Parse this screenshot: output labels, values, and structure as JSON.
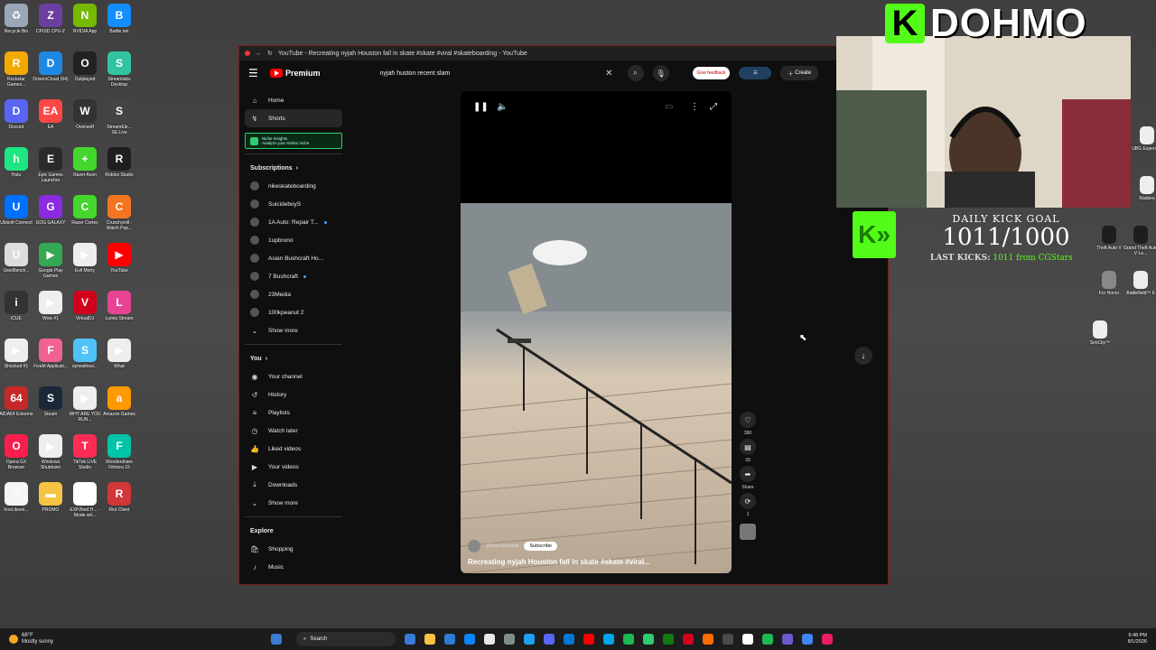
{
  "desktop": {
    "icons": [
      {
        "label": "Recycle Bin",
        "color": "#9aa7b8",
        "glyph": "♻"
      },
      {
        "label": "CPUID CPU-Z",
        "color": "#6b3fa0",
        "glyph": "Z"
      },
      {
        "label": "NVIDIA App",
        "color": "#76b900",
        "glyph": "N"
      },
      {
        "label": "Battle.net",
        "color": "#148eff",
        "glyph": "B"
      },
      {
        "label": "Rockstar Games...",
        "color": "#f2a900",
        "glyph": "R"
      },
      {
        "label": "DriversCloud (64)",
        "color": "#1e88e5",
        "glyph": "D"
      },
      {
        "label": "Outplayed",
        "color": "#222222",
        "glyph": "O"
      },
      {
        "label": "Streamlabs Desktop",
        "color": "#31c3a2",
        "glyph": "S"
      },
      {
        "label": "Discord",
        "color": "#5865f2",
        "glyph": "D"
      },
      {
        "label": "EA",
        "color": "#ff4747",
        "glyph": "EA"
      },
      {
        "label": "Overwolf",
        "color": "#333333",
        "glyph": "W"
      },
      {
        "label": "StreamEle... SE.Live",
        "color": "#444444",
        "glyph": "S"
      },
      {
        "label": "Hulu",
        "color": "#1ce783",
        "glyph": "h"
      },
      {
        "label": "Epic Games Launcher",
        "color": "#2a2a2a",
        "glyph": "E"
      },
      {
        "label": "Razer Axon",
        "color": "#44d62c",
        "glyph": "+"
      },
      {
        "label": "Roblox Studio",
        "color": "#1f1f1f",
        "glyph": "R"
      },
      {
        "label": "Ubisoft Connect",
        "color": "#0070ff",
        "glyph": "U"
      },
      {
        "label": "GOG GALAXY",
        "color": "#8a2be2",
        "glyph": "G"
      },
      {
        "label": "Razer Cortex",
        "color": "#44d62c",
        "glyph": "C"
      },
      {
        "label": "Crunchyroll - Watch Pop...",
        "color": "#f47521",
        "glyph": "C"
      },
      {
        "label": "UserBench...",
        "color": "#dddddd",
        "glyph": "U"
      },
      {
        "label": "Google Play Games",
        "color": "#34a853",
        "glyph": "▶"
      },
      {
        "label": "Evil Morty",
        "color": "#eeeeee",
        "glyph": "▶"
      },
      {
        "label": "YouTube",
        "color": "#ff0000",
        "glyph": "▶"
      },
      {
        "label": "iCUE",
        "color": "#333333",
        "glyph": "i"
      },
      {
        "label": "Wow #1",
        "color": "#eeeeee",
        "glyph": "▶"
      },
      {
        "label": "VirtualDJ",
        "color": "#d0021b",
        "glyph": "V"
      },
      {
        "label": "Lumia Stream",
        "color": "#e84393",
        "glyph": "L"
      },
      {
        "label": "Shocked #1",
        "color": "#eeeeee",
        "glyph": "▶"
      },
      {
        "label": "FiveM Applicati...",
        "color": "#f06292",
        "glyph": "F"
      },
      {
        "label": "synesthesi...",
        "color": "#4fc3f7",
        "glyph": "S"
      },
      {
        "label": "What",
        "color": "#eeeeee",
        "glyph": "▶"
      },
      {
        "label": "AIDA64 Extreme",
        "color": "#c62828",
        "glyph": "64"
      },
      {
        "label": "Steam",
        "color": "#1b2838",
        "glyph": "S"
      },
      {
        "label": "WHY ARE YOU RUN...",
        "color": "#eeeeee",
        "glyph": "▶"
      },
      {
        "label": "Amazon Games",
        "color": "#ff9900",
        "glyph": "a"
      },
      {
        "label": "Opera GX Browser",
        "color": "#fa1e4e",
        "glyph": "O"
      },
      {
        "label": "Windows Shutdown",
        "color": "#eeeeee",
        "glyph": "▶"
      },
      {
        "label": "TikTok LIVE Studio",
        "color": "#fe2c55",
        "glyph": "T"
      },
      {
        "label": "Wondershare Filmora 15",
        "color": "#00c4a7",
        "glyph": "F"
      },
      {
        "label": "host.devel...",
        "color": "#f5f5f5",
        "glyph": "≡"
      },
      {
        "label": "PROMO",
        "color": "#f6c343",
        "glyph": "▬"
      },
      {
        "label": "EXP.Beef.H... - Mode wit...",
        "color": "#ffffff",
        "glyph": "W"
      },
      {
        "label": "Riot Client",
        "color": "#d13639",
        "glyph": "R"
      }
    ],
    "right_icons": [
      {
        "label": "UBG Experie...",
        "color": "#eeeeee"
      },
      {
        "label": "Raiders",
        "color": "#eeeeee"
      },
      {
        "label": "Theft Auto V",
        "color": "#1e1e1e"
      },
      {
        "label": "Grand Theft Auto V Le...",
        "color": "#1e1e1e"
      },
      {
        "label": "For Honor",
        "color": "#888888"
      },
      {
        "label": "Battlefield™ 6",
        "color": "#eeeeee"
      },
      {
        "label": "SimCity™",
        "color": "#eeeeee"
      }
    ]
  },
  "window": {
    "title": "YouTube - Recreating nyjah Houston fall in skate #skate #viral #skateboarding - YouTube",
    "controls": "···"
  },
  "header": {
    "logo": "Premium",
    "search_value": "nyjah huston recent slam",
    "feedback_label": "Give feedback",
    "create_label": "Create"
  },
  "sidebar": {
    "main": [
      {
        "label": "Home",
        "icon": "⌂",
        "name": "home"
      },
      {
        "label": "Shorts",
        "icon": "↯",
        "name": "shorts",
        "active": true
      }
    ],
    "niche": {
      "title": "Niche Insights",
      "subtitle": "Analyze your similar niche"
    },
    "subscriptions_heading": "Subscriptions",
    "subscriptions": [
      {
        "label": "nikeskateboarding",
        "live": false
      },
      {
        "label": "SuicideboyS",
        "live": false
      },
      {
        "label": "1A Auto: Repair T...",
        "live": true
      },
      {
        "label": "1upbruno",
        "live": false
      },
      {
        "label": "Asian Bushcraft Ho...",
        "live": false
      },
      {
        "label": "7 Bushcraft",
        "live": true
      },
      {
        "label": "23Media",
        "live": false
      },
      {
        "label": "100kpeanut 2",
        "live": false
      }
    ],
    "subs_show_more": "Show more",
    "you_heading": "You",
    "you_items": [
      {
        "label": "Your channel",
        "icon": "◉",
        "name": "your-channel"
      },
      {
        "label": "History",
        "icon": "↺",
        "name": "history"
      },
      {
        "label": "Playlists",
        "icon": "≡",
        "name": "playlists"
      },
      {
        "label": "Watch later",
        "icon": "◷",
        "name": "watch-later"
      },
      {
        "label": "Liked videos",
        "icon": "👍",
        "name": "liked-videos"
      },
      {
        "label": "Your videos",
        "icon": "▶",
        "name": "your-videos"
      },
      {
        "label": "Downloads",
        "icon": "⤓",
        "name": "downloads"
      }
    ],
    "you_show_more": "Show more",
    "explore_heading": "Explore",
    "explore_items": [
      {
        "label": "Shopping",
        "icon": "🛍",
        "name": "shopping"
      },
      {
        "label": "Music",
        "icon": "♪",
        "name": "music"
      }
    ]
  },
  "player": {
    "channel_handle": "@MacCastaway",
    "subscribe_label": "Subscribe",
    "video_title": "Recreating nyjah Houston fall in skate #skate #viral...",
    "likes": "390",
    "comments": "33",
    "share_label": "Share",
    "remix_count": "1"
  },
  "overlay": {
    "brand_name": "DOHMO",
    "goal_title": "DAILY KICK GOAL",
    "goal_value": "1011/1000",
    "goal_progress": 1.0,
    "last_kicks_label": "LAST KICKS:",
    "last_kicks_value": "1011 from CGStars"
  },
  "taskbar": {
    "weather_temp": "68°F",
    "weather_desc": "Mostly sunny",
    "search_label": "Search",
    "time": "6:48 PM",
    "date": "8/1/2026",
    "apps": [
      "#3a7bd5",
      "#f6c343",
      "#2d7dd2",
      "#0a84ff",
      "#e8e8e8",
      "#7f8c8d",
      "#1da1f2",
      "#5865f2",
      "#0078d4",
      "#ff0000",
      "#00a4ef",
      "#1db954",
      "#2ecc71",
      "#107c10",
      "#d0021b",
      "#ff6d00",
      "#4a4a4a",
      "#ffffff",
      "#1db954",
      "#6a5acd",
      "#4285f4",
      "#e91e63"
    ]
  }
}
